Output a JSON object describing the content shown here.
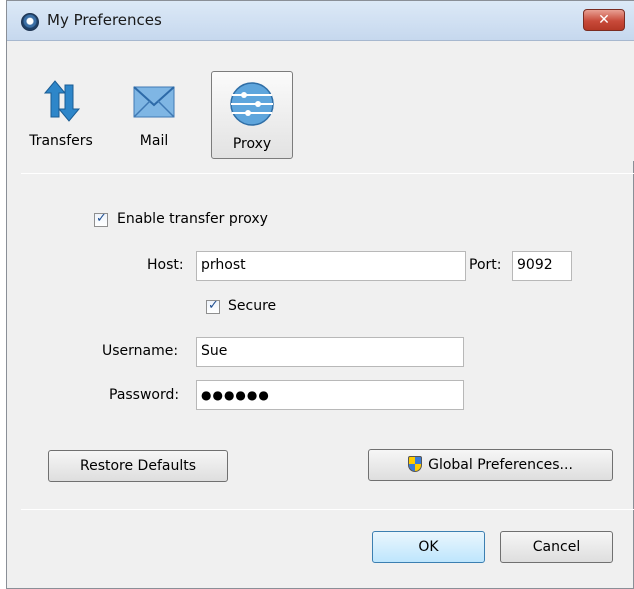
{
  "window": {
    "title": "My Preferences",
    "close_glyph": "✕"
  },
  "toolbar": {
    "items": [
      {
        "label": "Transfers",
        "icon": "transfers-arrows-icon"
      },
      {
        "label": "Mail",
        "icon": "mail-envelope-icon"
      },
      {
        "label": "Proxy",
        "icon": "proxy-globe-icon",
        "selected": true
      }
    ]
  },
  "proxy": {
    "enable_label": "Enable transfer proxy",
    "enable_checked": true,
    "host_label": "Host:",
    "host_value": "prhost",
    "port_label": "Port:",
    "port_value": "9092",
    "secure_label": "Secure",
    "secure_checked": true,
    "username_label": "Username:",
    "username_value": "Sue",
    "password_label": "Password:",
    "password_mask": "●●●●●●"
  },
  "buttons": {
    "restore": "Restore Defaults",
    "global": "Global Preferences...",
    "ok": "OK",
    "cancel": "Cancel"
  }
}
